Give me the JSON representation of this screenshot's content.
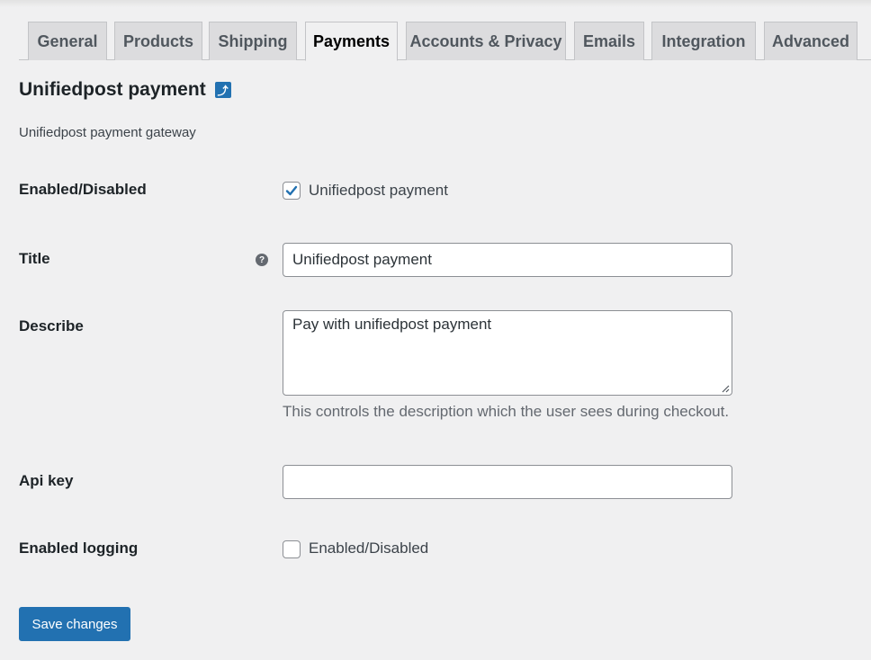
{
  "tabs": [
    {
      "label": "General",
      "active": false
    },
    {
      "label": "Products",
      "active": false
    },
    {
      "label": "Shipping",
      "active": false
    },
    {
      "label": "Payments",
      "active": true
    },
    {
      "label": "Accounts & Privacy",
      "active": false
    },
    {
      "label": "Emails",
      "active": false
    },
    {
      "label": "Integration",
      "active": false
    },
    {
      "label": "Advanced",
      "active": false
    }
  ],
  "section": {
    "title": "Unifiedpost payment",
    "back_icon": "return-arrow-icon",
    "subtitle": "Unifiedpost payment gateway"
  },
  "fields": {
    "enabled": {
      "label": "Enabled/Disabled",
      "checkbox_label": "Unifiedpost payment",
      "checked": true
    },
    "title": {
      "label": "Title",
      "value": "Unifiedpost payment",
      "help_icon": "question-circle-icon"
    },
    "describe": {
      "label": "Describe",
      "value": "Pay with unifiedpost payment",
      "description": "This controls the description which the user sees during checkout."
    },
    "api_key": {
      "label": "Api key",
      "value": ""
    },
    "logging": {
      "label": "Enabled logging",
      "checkbox_label": "Enabled/Disabled",
      "checked": false
    }
  },
  "actions": {
    "save_label": "Save changes"
  },
  "colors": {
    "accent": "#2271b1",
    "background": "#f0f0f1",
    "tab_inactive": "#dcdcde"
  }
}
